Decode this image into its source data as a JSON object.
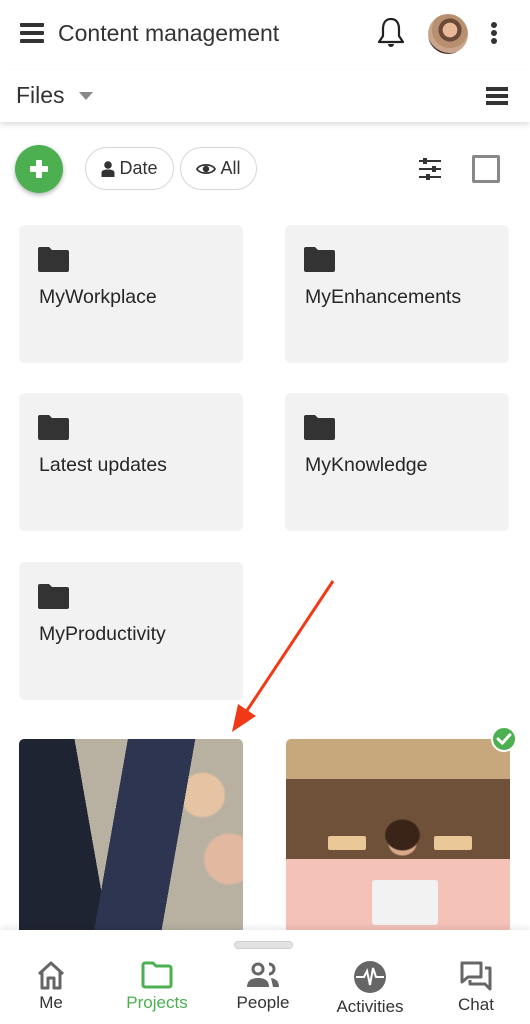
{
  "header": {
    "title": "Content management",
    "menu_icon": "hamburger-menu-icon",
    "notification_icon": "bell-icon",
    "avatar_alt": "User avatar",
    "more_icon": "kebab-menu-icon"
  },
  "subheader": {
    "section": "Files",
    "dropdown_icon": "caret-down-icon",
    "view_toggle_icon": "list-view-icon"
  },
  "toolbar": {
    "add_icon": "plus-icon",
    "chips": [
      {
        "label": "Date",
        "icon": "person-icon"
      },
      {
        "label": "All",
        "icon": "eye-icon"
      }
    ],
    "filter_icon": "sliders-icon",
    "select_icon": "checkbox-icon"
  },
  "folders": [
    {
      "name": "MyWorkplace"
    },
    {
      "name": "MyEnhancements"
    },
    {
      "name": "Latest updates"
    },
    {
      "name": "MyKnowledge"
    },
    {
      "name": "MyProductivity"
    }
  ],
  "images": [
    {
      "description": "Business people meeting photo",
      "selected": false
    },
    {
      "description": "Woman with laptop photo",
      "selected": true
    }
  ],
  "colors": {
    "accent": "#4caf50",
    "annotation_arrow": "#f03a17",
    "card_bg": "#f2f2f2",
    "text": "#333333"
  },
  "bottom_nav": {
    "items": [
      {
        "label": "Me",
        "icon": "home-icon",
        "active": false
      },
      {
        "label": "Projects",
        "icon": "folder-outline-icon",
        "active": true
      },
      {
        "label": "People",
        "icon": "people-icon",
        "active": false
      },
      {
        "label": "Activities",
        "icon": "activity-pulse-icon",
        "active": false
      },
      {
        "label": "Chat",
        "icon": "chat-icon",
        "active": false
      }
    ]
  }
}
